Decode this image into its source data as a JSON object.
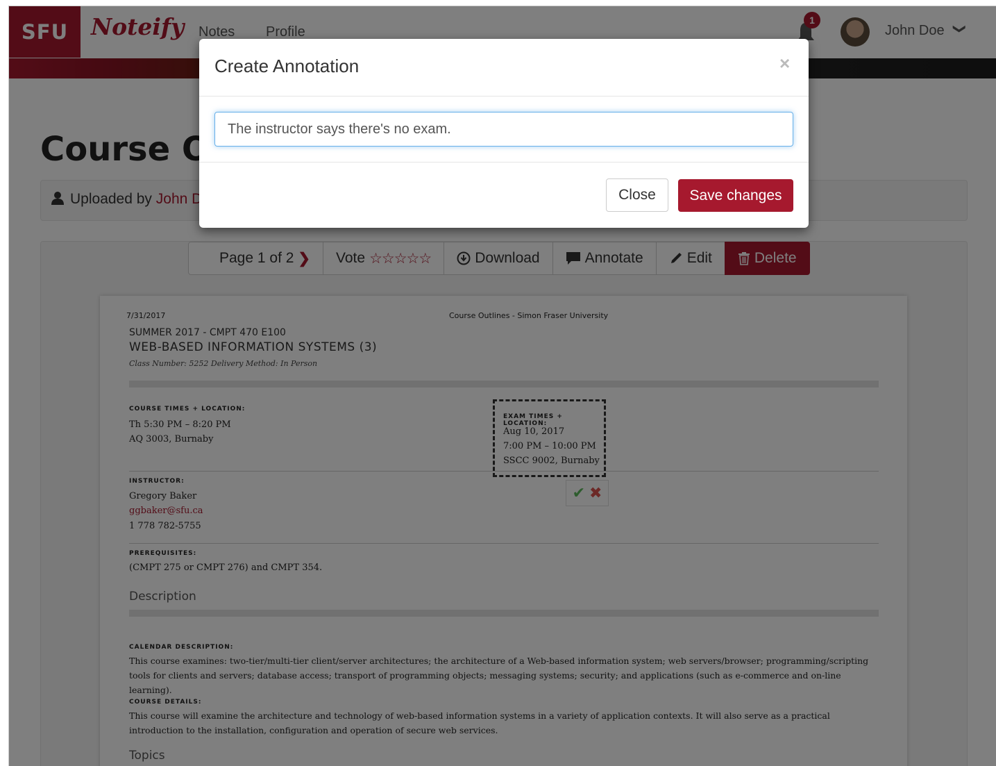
{
  "navbar": {
    "brand_sfu": "SFU",
    "brand_name": "Noteify",
    "links": [
      "Notes",
      "Profile"
    ],
    "notification_count": "1",
    "user_name": "John Doe",
    "user_chevron": "❯"
  },
  "page": {
    "title": "Course Outline",
    "uploaded_prefix": "Uploaded by ",
    "uploaded_user": "John Doe"
  },
  "toolbar": {
    "page_label": "Page 1 of 2",
    "next_icon": "❯",
    "vote_label": "Vote",
    "stars": "☆☆☆☆☆",
    "download_label": "Download",
    "annotate_label": "Annotate",
    "edit_label": "Edit",
    "delete_label": "Delete"
  },
  "document": {
    "date": "7/31/2017",
    "header": "Course Outlines - Simon Fraser University",
    "term": "SUMMER 2017 - CMPT 470 E100",
    "course": "WEB-BASED INFORMATION SYSTEMS (3)",
    "class_info": "Class Number: 5252    Delivery Method: In Person",
    "times_label": "COURSE TIMES + LOCATION:",
    "times_line1": "Th 5:30 PM – 8:20 PM",
    "times_line2": "AQ 3003, Burnaby",
    "exam_label": "EXAM TIMES + LOCATION:",
    "exam_line1": "Aug 10, 2017",
    "exam_line2": "7:00 PM – 10:00 PM",
    "exam_line3": "SSCC 9002, Burnaby",
    "instructor_label": "INSTRUCTOR:",
    "instructor_name": "Gregory Baker",
    "instructor_email": "ggbaker@sfu.ca",
    "instructor_phone": "1 778 782-5755",
    "prereq_label": "PREREQUISITES:",
    "prereq_text": "(CMPT 275 or CMPT 276) and CMPT 354.",
    "description_heading": "Description",
    "calendar_label": "CALENDAR DESCRIPTION:",
    "calendar_text": "This course examines: two-tier/multi-tier client/server architectures; the architecture of a Web-based information system; web servers/browser; programming/scripting tools for clients and servers; database access; transport of programming objects; messaging systems; security; and applications (such as e-commerce and on-line learning).",
    "details_label": "COURSE DETAILS:",
    "details_text": "This course will examine the architecture and technology of web-based information systems in a variety of application contexts. It will also serve as a practical introduction to the installation, configuration and operation of secure web services.",
    "topics_heading": "Topics"
  },
  "annotation_actions": {
    "accept": "✔",
    "reject": "✖"
  },
  "modal": {
    "title": "Create Annotation",
    "close_x": "×",
    "input_value": "The instructor says there's no exam.",
    "close_button": "Close",
    "save_button": "Save changes"
  },
  "colors": {
    "brand": "#a6192e",
    "focus": "#66afe9"
  }
}
